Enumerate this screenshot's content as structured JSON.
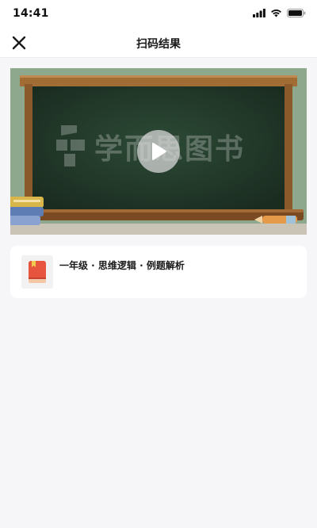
{
  "status_bar": {
    "time": "14:41",
    "icons": [
      "signal-icon",
      "wifi-icon",
      "battery-icon"
    ]
  },
  "nav": {
    "title": "扫码结果",
    "close_icon": "close-icon"
  },
  "video": {
    "watermark": "学而思图书",
    "play_icon": "play-icon"
  },
  "book": {
    "title": "一年级 · 思维逻辑 · 例题解析",
    "icon": "book-icon"
  },
  "colors": {
    "background": "#f6f6f9",
    "chalkboard": "#24402e",
    "frame": "#8b5a2b",
    "book_icon": "#e8553f"
  }
}
